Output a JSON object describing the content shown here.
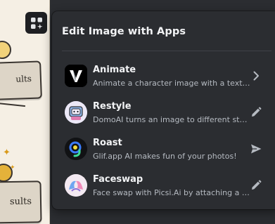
{
  "panel": {
    "title": "Edit Image with Apps"
  },
  "background": {
    "card_text_1": "ults",
    "card_text_2": "sults"
  },
  "apps": [
    {
      "name": "Animate",
      "description": "Animate a character image with a text pr...",
      "icon": "animate-v-logo-icon",
      "action_icon": "chevron-right-icon"
    },
    {
      "name": "Restyle",
      "description": "DomoAI turns an image to different styles",
      "icon": "domoai-avatar-icon",
      "action_icon": "pencil-icon"
    },
    {
      "name": "Roast",
      "description": "Glif.app AI makes fun of your photos!",
      "icon": "glif-avatar-icon",
      "action_icon": "send-icon"
    },
    {
      "name": "Faceswap",
      "description": "Face swap with Picsi.Ai by attaching a so...",
      "icon": "picsi-avatar-icon",
      "action_icon": "pencil-icon"
    }
  ],
  "colors": {
    "panel_bg": "#2b2d31",
    "title": "#f2f3f5",
    "description": "#b5bac1",
    "icon_gray": "#b5bac1"
  }
}
